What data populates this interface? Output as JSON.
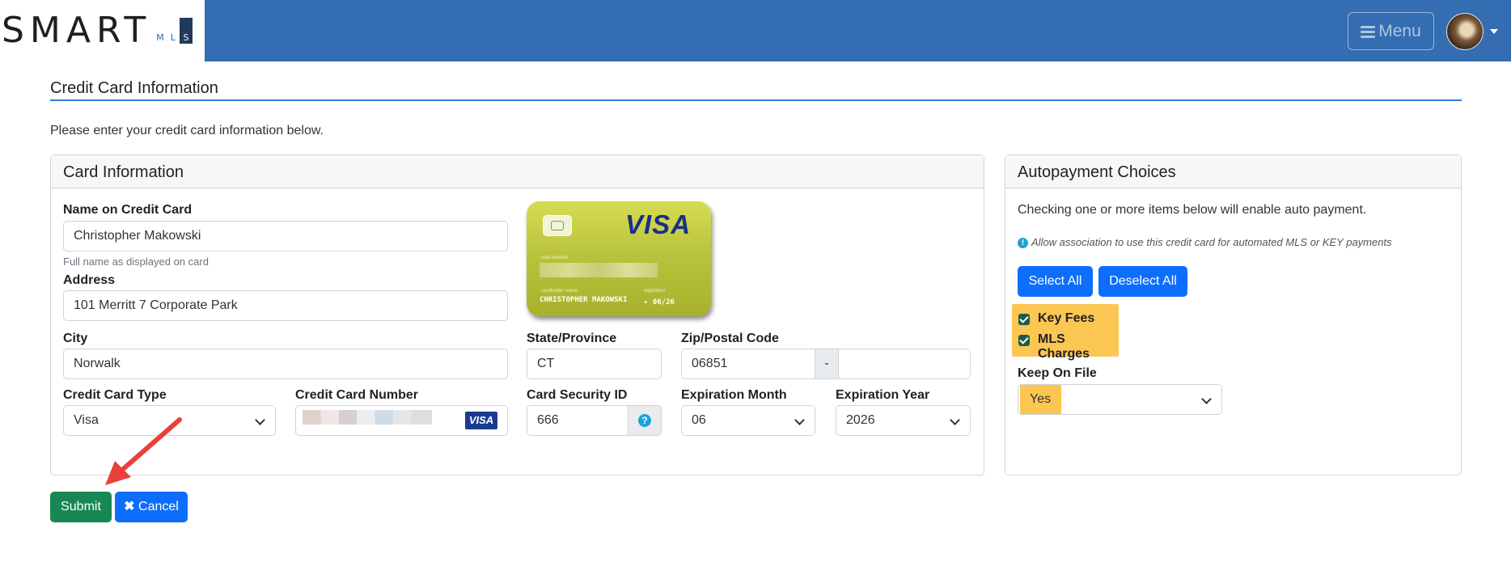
{
  "header": {
    "logo_text": "SMART",
    "logo_sub": [
      "M",
      "L",
      "S"
    ],
    "menu_label": "Menu"
  },
  "page": {
    "title": "Credit Card Information",
    "intro": "Please enter your credit card information below."
  },
  "card_panel": {
    "title": "Card Information",
    "name_label": "Name on Credit Card",
    "name_value": "Christopher Makowski",
    "name_help": "Full name as displayed on card",
    "address_label": "Address",
    "address_value": "101 Merritt 7 Corporate Park",
    "city_label": "City",
    "city_value": "Norwalk",
    "state_label": "State/Province",
    "state_value": "CT",
    "zip_label": "Zip/Postal Code",
    "zip_value": "06851",
    "zip_sep": "-",
    "zip_ext_value": "",
    "type_label": "Credit Card Type",
    "type_value": "Visa",
    "number_label": "Credit Card Number",
    "number_badge": "VISA",
    "cvv_label": "Card Security ID",
    "cvv_value": "666",
    "cvv_help_icon": "?",
    "exp_month_label": "Expiration Month",
    "exp_month_value": "06",
    "exp_year_label": "Expiration Year",
    "exp_year_value": "2026"
  },
  "card_preview": {
    "brand": "VISA",
    "number_label": "card number",
    "holder_label": "cardholder name",
    "holder_name": "CHRISTOPHER MAKOWSKI",
    "exp_label": "expiration",
    "exp_value": "▸ 06/26"
  },
  "autopay": {
    "title": "Autopayment Choices",
    "description": "Checking one or more items below will enable auto payment.",
    "note": "Allow association to use this credit card for automated MLS or KEY payments",
    "select_all": "Select All",
    "deselect_all": "Deselect All",
    "options": [
      {
        "label": "Key Fees",
        "checked": true
      },
      {
        "label": "MLS Charges",
        "checked": true
      }
    ],
    "keep_label": "Keep On File",
    "keep_value": "Yes"
  },
  "actions": {
    "submit": "Submit",
    "cancel": "Cancel"
  },
  "colors": {
    "header_bg": "#346db1",
    "primary": "#0d6efd",
    "success": "#198754",
    "highlight": "#fcc653",
    "annotation_arrow": "#e8413a"
  }
}
